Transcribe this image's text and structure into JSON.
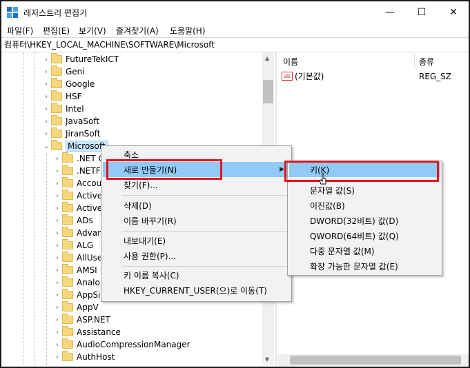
{
  "window": {
    "title": "레지스트리 편집기",
    "controls": {
      "minimize": "—",
      "maximize": "☐",
      "close": "✕"
    }
  },
  "menu": [
    "파일(F)",
    "편집(E)",
    "보기(V)",
    "즐겨찾기(A)",
    "도움말(H)"
  ],
  "address": "컴퓨터\\HKEY_LOCAL_MACHINE\\SOFTWARE\\Microsoft",
  "tree": {
    "upper": [
      "FutureTekICT",
      "Geni",
      "Google",
      "HSF",
      "Intel",
      "JavaSoft",
      "JiranSoft"
    ],
    "selected": "Microsoft",
    "children": [
      ".NET C",
      ".NETF",
      "Accou",
      "Active",
      "Active",
      "ADs",
      "Advar",
      "ALG",
      "AllUse",
      "AMSI",
      "Analo",
      "AppSi",
      "AppV",
      "ASP.NET",
      "Assistance",
      "AudioCompressionManager",
      "AuthHost"
    ]
  },
  "values_pane": {
    "col_name": "이름",
    "col_type": "종류",
    "rows": [
      {
        "name": "(기본값)",
        "type": "REG_SZ",
        "icon": "ab"
      }
    ]
  },
  "context_menu": {
    "items": [
      {
        "label": "축소"
      },
      {
        "label": "새로 만들기(N)",
        "submenu": true,
        "highlighted": true
      },
      {
        "label": "찾기(F)..."
      },
      {
        "label": "삭제(D)"
      },
      {
        "label": "이름 바꾸기(R)"
      },
      {
        "label": "내보내기(E)"
      },
      {
        "label": "사용 권한(P)..."
      },
      {
        "label": "키 이름 복사(C)"
      },
      {
        "label": "HKEY_CURRENT_USER(으)로 이동(T)"
      }
    ]
  },
  "submenu": {
    "items": [
      {
        "label": "키(K)",
        "highlighted": true
      },
      {
        "label": "문자열 값(S)"
      },
      {
        "label": "이진값(B)"
      },
      {
        "label": "DWORD(32비트) 값(D)"
      },
      {
        "label": "QWORD(64비트) 값(Q)"
      },
      {
        "label": "다중 문자열 값(M)"
      },
      {
        "label": "확장 가능한 문자열 값(E)"
      }
    ]
  },
  "colors": {
    "highlight": "#91c9f7",
    "annotation": "#e3141b",
    "folder": "#f5d77e"
  }
}
